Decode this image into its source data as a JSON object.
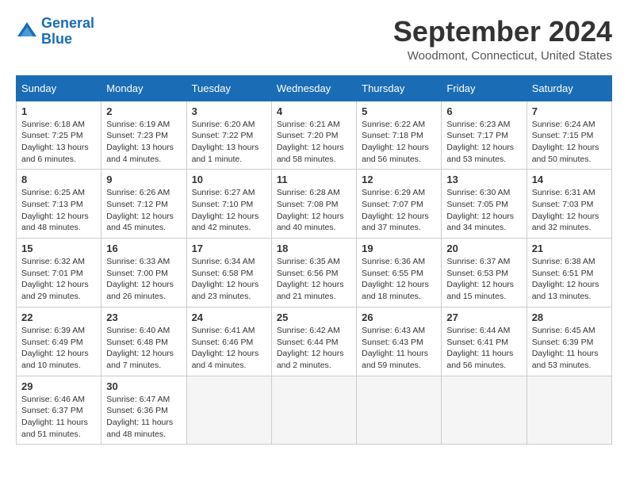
{
  "header": {
    "logo_line1": "General",
    "logo_line2": "Blue",
    "title": "September 2024",
    "location": "Woodmont, Connecticut, United States"
  },
  "days_of_week": [
    "Sunday",
    "Monday",
    "Tuesday",
    "Wednesday",
    "Thursday",
    "Friday",
    "Saturday"
  ],
  "weeks": [
    [
      {
        "day": "1",
        "info": "Sunrise: 6:18 AM\nSunset: 7:25 PM\nDaylight: 13 hours\nand 6 minutes."
      },
      {
        "day": "2",
        "info": "Sunrise: 6:19 AM\nSunset: 7:23 PM\nDaylight: 13 hours\nand 4 minutes."
      },
      {
        "day": "3",
        "info": "Sunrise: 6:20 AM\nSunset: 7:22 PM\nDaylight: 13 hours\nand 1 minute."
      },
      {
        "day": "4",
        "info": "Sunrise: 6:21 AM\nSunset: 7:20 PM\nDaylight: 12 hours\nand 58 minutes."
      },
      {
        "day": "5",
        "info": "Sunrise: 6:22 AM\nSunset: 7:18 PM\nDaylight: 12 hours\nand 56 minutes."
      },
      {
        "day": "6",
        "info": "Sunrise: 6:23 AM\nSunset: 7:17 PM\nDaylight: 12 hours\nand 53 minutes."
      },
      {
        "day": "7",
        "info": "Sunrise: 6:24 AM\nSunset: 7:15 PM\nDaylight: 12 hours\nand 50 minutes."
      }
    ],
    [
      {
        "day": "8",
        "info": "Sunrise: 6:25 AM\nSunset: 7:13 PM\nDaylight: 12 hours\nand 48 minutes."
      },
      {
        "day": "9",
        "info": "Sunrise: 6:26 AM\nSunset: 7:12 PM\nDaylight: 12 hours\nand 45 minutes."
      },
      {
        "day": "10",
        "info": "Sunrise: 6:27 AM\nSunset: 7:10 PM\nDaylight: 12 hours\nand 42 minutes."
      },
      {
        "day": "11",
        "info": "Sunrise: 6:28 AM\nSunset: 7:08 PM\nDaylight: 12 hours\nand 40 minutes."
      },
      {
        "day": "12",
        "info": "Sunrise: 6:29 AM\nSunset: 7:07 PM\nDaylight: 12 hours\nand 37 minutes."
      },
      {
        "day": "13",
        "info": "Sunrise: 6:30 AM\nSunset: 7:05 PM\nDaylight: 12 hours\nand 34 minutes."
      },
      {
        "day": "14",
        "info": "Sunrise: 6:31 AM\nSunset: 7:03 PM\nDaylight: 12 hours\nand 32 minutes."
      }
    ],
    [
      {
        "day": "15",
        "info": "Sunrise: 6:32 AM\nSunset: 7:01 PM\nDaylight: 12 hours\nand 29 minutes."
      },
      {
        "day": "16",
        "info": "Sunrise: 6:33 AM\nSunset: 7:00 PM\nDaylight: 12 hours\nand 26 minutes."
      },
      {
        "day": "17",
        "info": "Sunrise: 6:34 AM\nSunset: 6:58 PM\nDaylight: 12 hours\nand 23 minutes."
      },
      {
        "day": "18",
        "info": "Sunrise: 6:35 AM\nSunset: 6:56 PM\nDaylight: 12 hours\nand 21 minutes."
      },
      {
        "day": "19",
        "info": "Sunrise: 6:36 AM\nSunset: 6:55 PM\nDaylight: 12 hours\nand 18 minutes."
      },
      {
        "day": "20",
        "info": "Sunrise: 6:37 AM\nSunset: 6:53 PM\nDaylight: 12 hours\nand 15 minutes."
      },
      {
        "day": "21",
        "info": "Sunrise: 6:38 AM\nSunset: 6:51 PM\nDaylight: 12 hours\nand 13 minutes."
      }
    ],
    [
      {
        "day": "22",
        "info": "Sunrise: 6:39 AM\nSunset: 6:49 PM\nDaylight: 12 hours\nand 10 minutes."
      },
      {
        "day": "23",
        "info": "Sunrise: 6:40 AM\nSunset: 6:48 PM\nDaylight: 12 hours\nand 7 minutes."
      },
      {
        "day": "24",
        "info": "Sunrise: 6:41 AM\nSunset: 6:46 PM\nDaylight: 12 hours\nand 4 minutes."
      },
      {
        "day": "25",
        "info": "Sunrise: 6:42 AM\nSunset: 6:44 PM\nDaylight: 12 hours\nand 2 minutes."
      },
      {
        "day": "26",
        "info": "Sunrise: 6:43 AM\nSunset: 6:43 PM\nDaylight: 11 hours\nand 59 minutes."
      },
      {
        "day": "27",
        "info": "Sunrise: 6:44 AM\nSunset: 6:41 PM\nDaylight: 11 hours\nand 56 minutes."
      },
      {
        "day": "28",
        "info": "Sunrise: 6:45 AM\nSunset: 6:39 PM\nDaylight: 11 hours\nand 53 minutes."
      }
    ],
    [
      {
        "day": "29",
        "info": "Sunrise: 6:46 AM\nSunset: 6:37 PM\nDaylight: 11 hours\nand 51 minutes."
      },
      {
        "day": "30",
        "info": "Sunrise: 6:47 AM\nSunset: 6:36 PM\nDaylight: 11 hours\nand 48 minutes."
      },
      {
        "day": "",
        "info": ""
      },
      {
        "day": "",
        "info": ""
      },
      {
        "day": "",
        "info": ""
      },
      {
        "day": "",
        "info": ""
      },
      {
        "day": "",
        "info": ""
      }
    ]
  ]
}
